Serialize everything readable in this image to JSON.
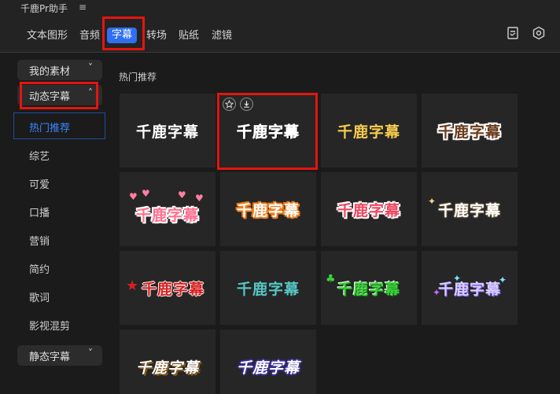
{
  "app": {
    "title": "千鹿Pr助手",
    "menu_icon": "hamburger-icon"
  },
  "tabs": [
    "文本图形",
    "音频",
    "字幕",
    "转场",
    "贴纸",
    "滤镜"
  ],
  "active_tab": "字幕",
  "toolbar_icons": [
    "checklist-icon",
    "gear-icon"
  ],
  "sidebar": {
    "my_assets": "我的素材",
    "animated": "动态字幕",
    "static": "静态字幕",
    "items": [
      "热门推荐",
      "综艺",
      "可爱",
      "口播",
      "营销",
      "简约",
      "歌词",
      "影视混剪"
    ],
    "active_item": "热门推荐"
  },
  "section_title": "热门推荐",
  "cards": [
    {
      "text": "千鹿字幕",
      "style": "plain-white"
    },
    {
      "text": "千鹿字幕",
      "style": "bold-outline-white"
    },
    {
      "text": "千鹿字幕",
      "style": "yellow"
    },
    {
      "text": "千鹿字幕",
      "style": "brown-white-outline"
    },
    {
      "text": "千鹿字幕",
      "style": "pink-hearts"
    },
    {
      "text": "千鹿字幕",
      "style": "orange-outline"
    },
    {
      "text": "千鹿字幕",
      "style": "red-white-outline"
    },
    {
      "text": "千鹿字幕",
      "style": "white-sparkle"
    },
    {
      "text": "千鹿字幕",
      "style": "red-star"
    },
    {
      "text": "千鹿字幕",
      "style": "teal"
    },
    {
      "text": "千鹿字幕",
      "style": "green-leaf"
    },
    {
      "text": "千鹿字幕",
      "style": "purple-sparkle"
    },
    {
      "text": "千鹿字幕",
      "style": "white-italic-brown"
    },
    {
      "text": "千鹿字幕",
      "style": "white-italic-purple"
    }
  ],
  "card_action_icons": [
    "star-icon",
    "download-icon"
  ],
  "highlight_color": "#e3150f",
  "accent_color": "#2f6ff0"
}
